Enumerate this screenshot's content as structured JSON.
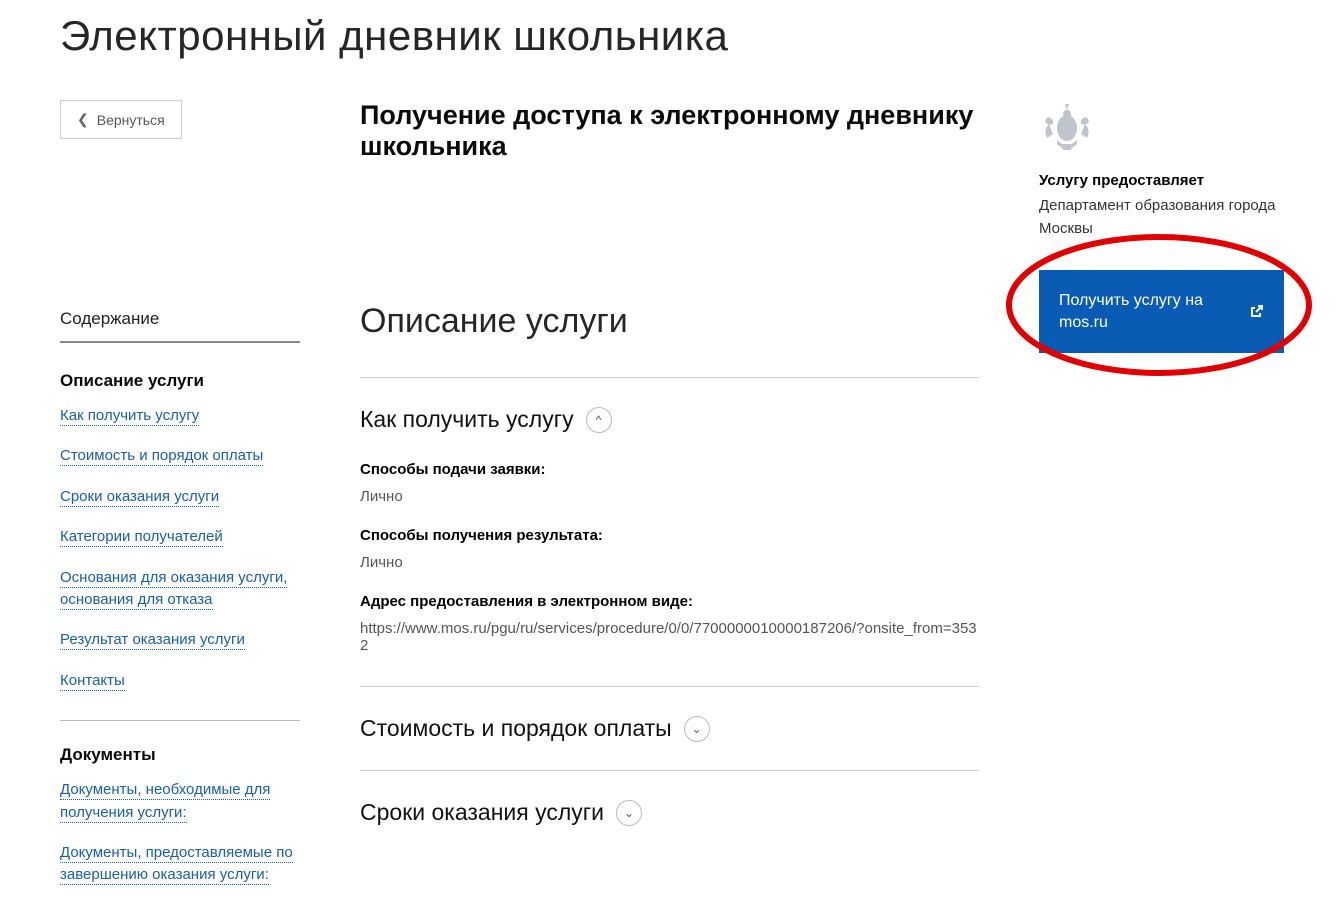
{
  "page_title": "Электронный дневник школьника",
  "back_label": "Вернуться",
  "subtitle": "Получение доступа к электронному дневнику школьника",
  "sidebar": {
    "heading": "Содержание",
    "section1_title": "Описание услуги",
    "links1": [
      "Как получить услугу",
      "Стоимость и порядок оплаты",
      "Сроки оказания услуги",
      "Категории получателей",
      "Основания для оказания услуги, основания для отказа",
      "Результат оказания услуги",
      "Контакты"
    ],
    "section2_title": "Документы",
    "links2": [
      "Документы, необходимые для получения услуги:",
      "Документы, предоставляемые по завершению оказания услуги:"
    ]
  },
  "main": {
    "section_heading": "Описание услуги",
    "accordion1": {
      "title": "Как получить услугу",
      "open": true,
      "fields": [
        {
          "label": "Способы подачи заявки:",
          "value": "Лично"
        },
        {
          "label": "Способы получения результата:",
          "value": "Лично"
        },
        {
          "label": "Адрес предоставления в электронном виде:",
          "value": "https://www.mos.ru/pgu/ru/services/procedure/0/0/7700000010000187206/?onsite_from=3532"
        }
      ]
    },
    "accordion2": {
      "title": "Стоимость и порядок оплаты",
      "open": false
    },
    "accordion3": {
      "title": "Сроки оказания услуги",
      "open": false
    }
  },
  "right": {
    "provider_label": "Услугу предоставляет",
    "provider_name": "Департамент образования города Москвы",
    "cta_label": "Получить услугу на mos.ru"
  }
}
